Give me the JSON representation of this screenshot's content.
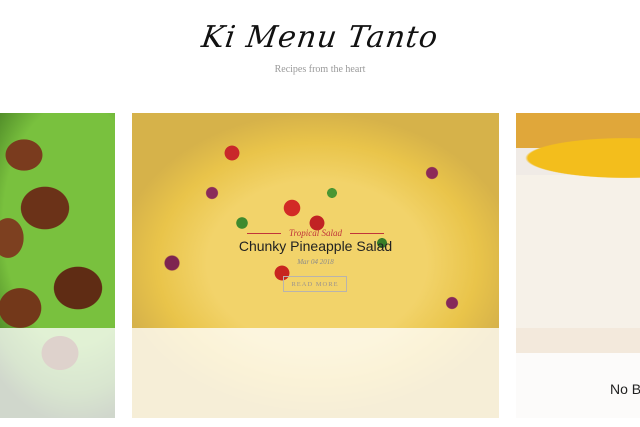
{
  "site": {
    "logo": "Ki Menu Tanto",
    "tagline": "Recipes from the heart"
  },
  "slides": [
    {
      "image": "fried-food-photo"
    },
    {
      "image": "pineapple-salad-photo",
      "category": "Tropical Salad",
      "title": "Chunky Pineapple Salad",
      "date": "Mar 04 2018",
      "button": "READ MORE"
    },
    {
      "image": "cheesecake-photo",
      "title": "No B"
    }
  ],
  "colors": {
    "accent": "#c0353a",
    "text": "#222222",
    "muted": "#9a9a9a"
  }
}
